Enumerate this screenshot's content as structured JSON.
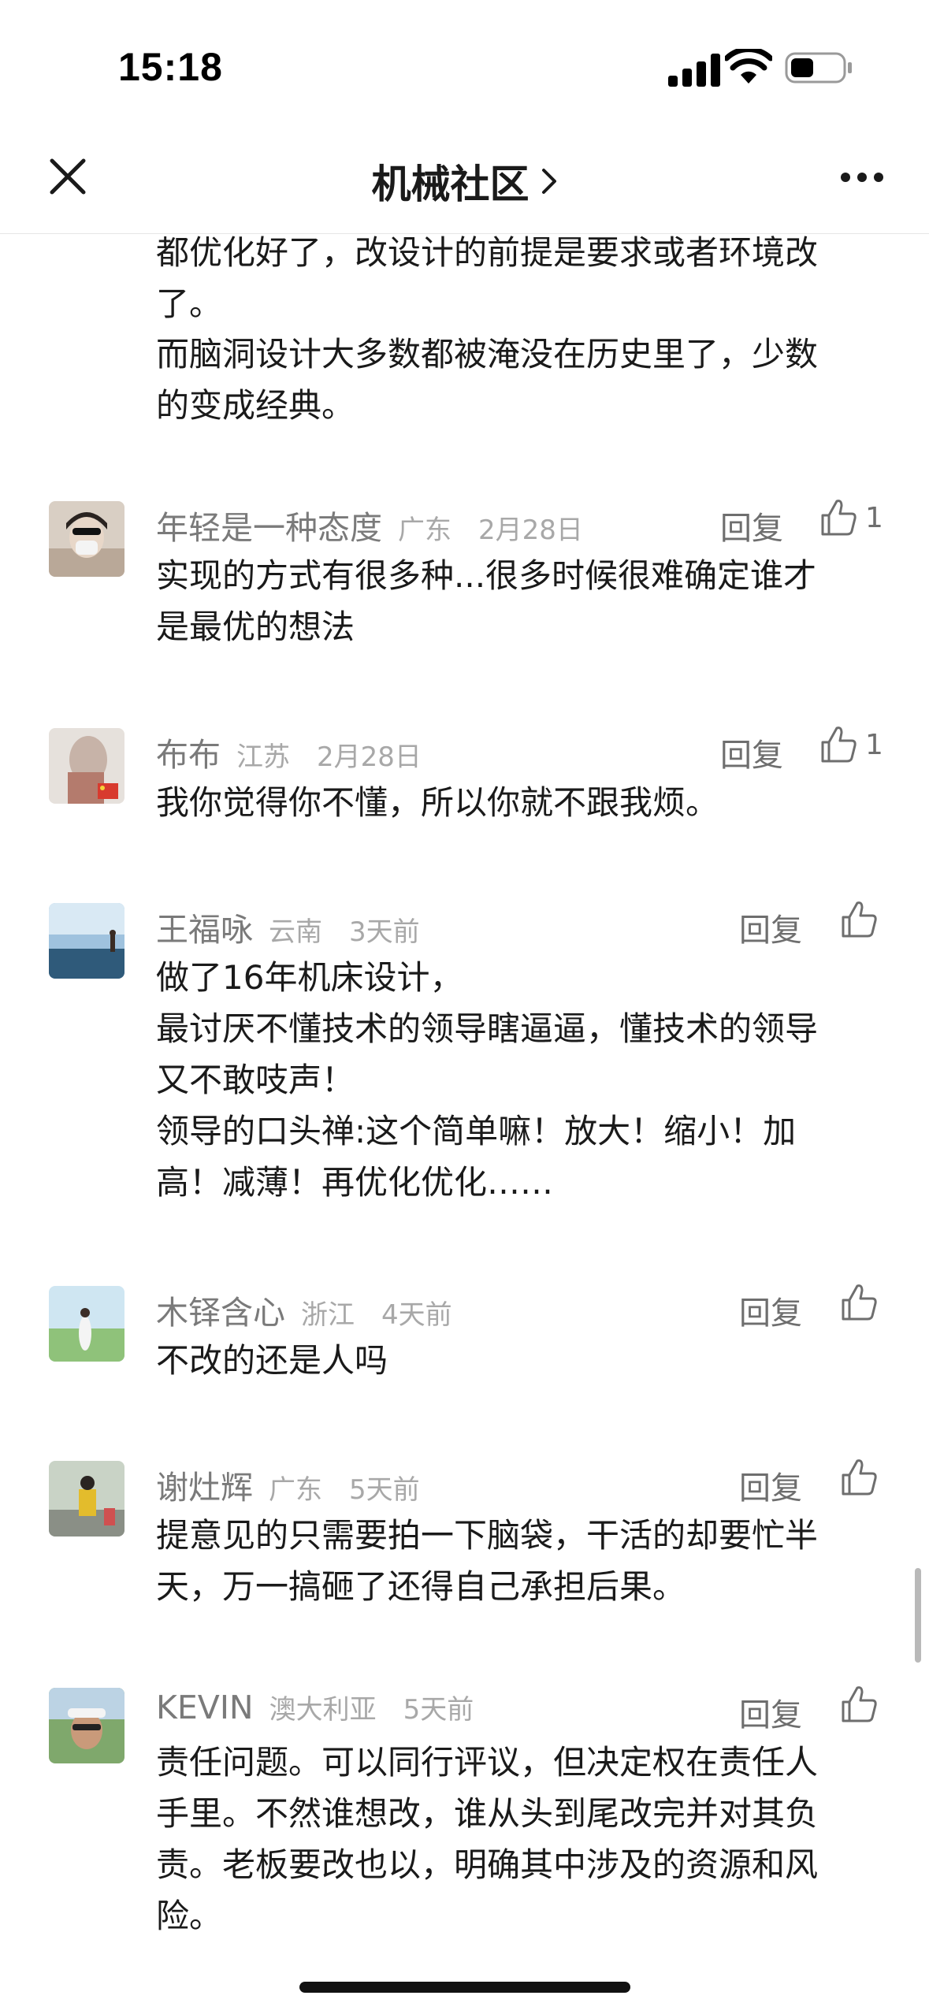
{
  "status_bar": {
    "time": "15:18"
  },
  "nav": {
    "title": "机械社区"
  },
  "top_comment_tail": [
    "都优化好了，改设计的前提是要求或者环境改",
    "了。",
    "而脑洞设计大多数都被淹没在历史里了，少数",
    "的变成经典。"
  ],
  "comments": [
    {
      "name": "年轻是一种态度",
      "location": "广东",
      "time": "2月28日",
      "reply": "回复",
      "likes": "1",
      "lines": [
        "实现的方式有很多种...很多时候很难确定谁才",
        "是最优的想法"
      ]
    },
    {
      "name": "布布",
      "location": "江苏",
      "time": "2月28日",
      "reply": "回复",
      "likes": "1",
      "lines": [
        "我你觉得你不懂，所以你就不跟我烦。"
      ]
    },
    {
      "name": "王福咏",
      "location": "云南",
      "time": "3天前",
      "reply": "回复",
      "likes": "",
      "lines": [
        "做了16年机床设计，",
        "最讨厌不懂技术的领导瞎逼逼，懂技术的领导",
        "又不敢吱声！",
        "领导的口头禅:这个简单嘛！放大！缩小！加",
        "高！减薄！再优化优化……"
      ]
    },
    {
      "name": "木铎含心",
      "location": "浙江",
      "time": "4天前",
      "reply": "回复",
      "likes": "",
      "lines": [
        "不改的还是人吗"
      ]
    },
    {
      "name": "谢灶辉",
      "location": "广东",
      "time": "5天前",
      "reply": "回复",
      "likes": "",
      "lines": [
        "提意见的只需要拍一下脑袋，干活的却要忙半",
        "天，万一搞砸了还得自己承担后果。"
      ]
    },
    {
      "name": "KEVIN",
      "location": "澳大利亚",
      "time": "5天前",
      "reply": "回复",
      "likes": "",
      "lines": [
        "责任问题。可以同行评议，但决定权在责任人",
        "手里。不然谁想改，谁从头到尾改完并对其负",
        "责。老板要改也以，明确其中涉及的资源和风",
        "险。"
      ]
    }
  ]
}
